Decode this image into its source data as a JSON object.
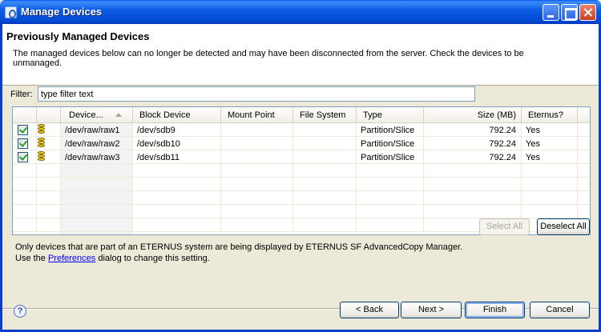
{
  "window": {
    "title": "Manage Devices"
  },
  "banner": {
    "title": "Previously Managed Devices",
    "message": "The managed devices below can no longer be detected and may have been disconnected from the server. Check the devices to be unmanaged."
  },
  "filter": {
    "label": "Filter:",
    "value": "type filter text"
  },
  "table": {
    "headers": [
      "Device...",
      "Block Device",
      "Mount Point",
      "File System",
      "Type",
      "Size (MB)",
      "Eternus?"
    ],
    "rows": [
      {
        "checked": true,
        "device": "/dev/raw/raw1",
        "block": "/dev/sdb9",
        "mount": "",
        "fs": "",
        "type": "Partition/Slice",
        "size": "792.24",
        "eternus": "Yes"
      },
      {
        "checked": true,
        "device": "/dev/raw/raw2",
        "block": "/dev/sdb10",
        "mount": "",
        "fs": "",
        "type": "Partition/Slice",
        "size": "792.24",
        "eternus": "Yes"
      },
      {
        "checked": true,
        "device": "/dev/raw/raw3",
        "block": "/dev/sdb11",
        "mount": "",
        "fs": "",
        "type": "Partition/Slice",
        "size": "792.24",
        "eternus": "Yes"
      }
    ]
  },
  "note": {
    "line1": "Only devices that are part of an ETERNUS system are being displayed by ETERNUS SF AdvancedCopy Manager.",
    "line2_pre": "Use the ",
    "line2_link": "Preferences",
    "line2_post": " dialog to change this setting."
  },
  "buttons": {
    "select_all": "Select All",
    "deselect_all": "Deselect All",
    "back": "< Back",
    "next": "Next >",
    "finish": "Finish",
    "cancel": "Cancel"
  },
  "help_icon": "?",
  "icons": [
    "app-icon",
    "minimize-icon",
    "maximize-icon",
    "close-icon",
    "help-icon",
    "database-icon",
    "sort-ascending-icon"
  ]
}
